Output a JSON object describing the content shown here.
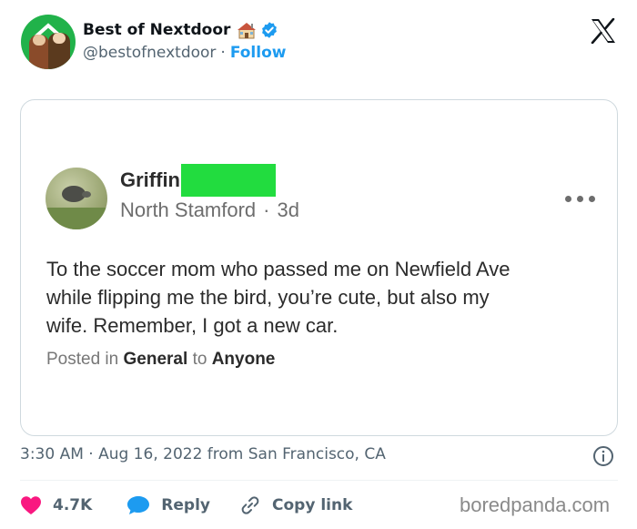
{
  "account": {
    "display_name": "Best of Nextdoor",
    "handle": "@bestofnextdoor",
    "separator": "·",
    "follow_label": "Follow"
  },
  "icons": {
    "avatar": "best-of-nextdoor-avatar",
    "house": "house-emoji-icon",
    "verified": "verified-badge-icon",
    "platform": "x-logo-icon",
    "more": "more-options-icon",
    "info": "info-icon",
    "like": "heart-icon",
    "reply": "speech-bubble-icon",
    "copy": "link-icon"
  },
  "post": {
    "author_name": "Griffin",
    "location": "North Stamford",
    "meta_separator": "·",
    "age": "3d",
    "body_lines": [
      "To the soccer mom who passed me on Newfield Ave",
      "while flipping me the bird, you’re cute, but also my",
      "wife. Remember, I got a new car."
    ],
    "posted_in_prefix": "Posted in",
    "category": "General",
    "to_word": "to",
    "audience": "Anyone"
  },
  "tweet": {
    "timestamp": "3:30 AM · Aug 16, 2022 from San Francisco, CA"
  },
  "actions": {
    "likes": "4.7K",
    "reply_label": "Reply",
    "copy_label": "Copy link"
  },
  "watermark": "boredpanda.com",
  "colors": {
    "accent": "#1d9bf0",
    "like": "#f91880",
    "verified": "#1d9bf0",
    "redaction": "#22dc3f",
    "avatar_bg": "#21b24a"
  }
}
